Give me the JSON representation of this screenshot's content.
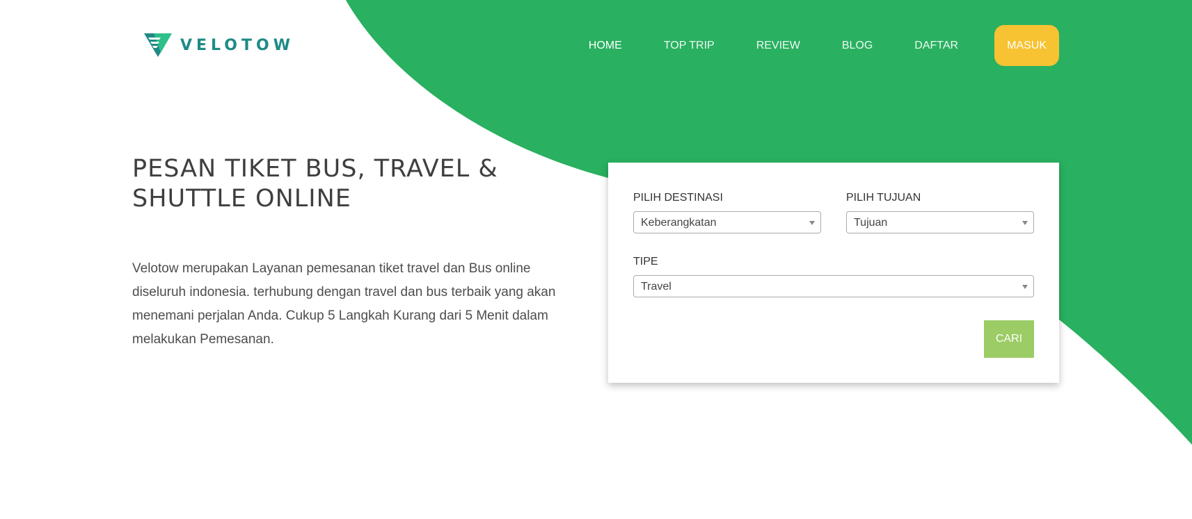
{
  "brand": {
    "name": "VELOTOW",
    "logo_icon": "velotow-logo-icon"
  },
  "colors": {
    "green_shape": "#29b060",
    "masuk_button": "#f7c332",
    "cari_button": "#9bcc65",
    "logo_teal": "#1f8a86"
  },
  "nav": {
    "items": [
      {
        "label": "HOME",
        "active": true
      },
      {
        "label": "TOP TRIP",
        "active": false
      },
      {
        "label": "REVIEW",
        "active": false
      },
      {
        "label": "BLOG",
        "active": false
      },
      {
        "label": "DAFTAR",
        "active": false
      }
    ],
    "login_label": "MASUK"
  },
  "hero": {
    "title": "PESAN TIKET BUS, TRAVEL & SHUTTLE ONLINE",
    "description": "Velotow merupakan Layanan pemesanan tiket travel dan Bus online diseluruh indonesia. terhubung dengan travel dan bus terbaik yang akan menemani perjalan Anda. Cukup 5 Langkah Kurang dari 5 Menit dalam melakukan Pemesanan."
  },
  "search": {
    "destination": {
      "label": "PILIH DESTINASI",
      "value": "Keberangkatan"
    },
    "target": {
      "label": "PILIH TUJUAN",
      "value": "Tujuan"
    },
    "type": {
      "label": "TIPE",
      "value": "Travel"
    },
    "submit_label": "CARI"
  }
}
